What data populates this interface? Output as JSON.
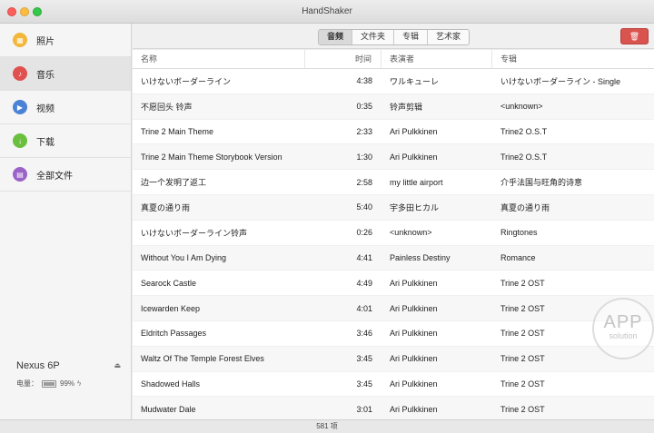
{
  "window": {
    "title": "HandShaker"
  },
  "sidebar": {
    "items": [
      {
        "label": "照片",
        "icon": "photo-icon",
        "color": "#f2b73b",
        "glyph": "▦"
      },
      {
        "label": "音乐",
        "icon": "music-icon",
        "color": "#e0504f",
        "glyph": "♪"
      },
      {
        "label": "视频",
        "icon": "video-icon",
        "color": "#4a82d6",
        "glyph": "▶"
      },
      {
        "label": "下载",
        "icon": "download-icon",
        "color": "#6bbf3f",
        "glyph": "↓"
      },
      {
        "label": "全部文件",
        "icon": "files-icon",
        "color": "#9b63c8",
        "glyph": "▤"
      }
    ],
    "device": {
      "name": "Nexus 6P",
      "battery_label": "电量：",
      "battery_percent": "99%",
      "battery_level": 0.99
    }
  },
  "toolbar": {
    "tabs": [
      "音频",
      "文件夹",
      "专辑",
      "艺术家"
    ],
    "active_tab": "音频",
    "delete_color": "#d9534f"
  },
  "table": {
    "columns": [
      "名称",
      "时间",
      "表演者",
      "专辑"
    ],
    "rows": [
      [
        "いけないボーダーライン",
        "4:38",
        "ワルキューレ",
        "いけないボーダーライン - Single"
      ],
      [
        "不愿回头 铃声",
        "0:35",
        "铃声剪辑",
        "<unknown>"
      ],
      [
        "Trine 2 Main Theme",
        "2:33",
        "Ari Pulkkinen",
        "Trine2 O.S.T"
      ],
      [
        "Trine 2 Main Theme Storybook Version",
        "1:30",
        "Ari Pulkkinen",
        "Trine2 O.S.T"
      ],
      [
        "边一个发明了返工",
        "2:58",
        "my little airport",
        "介乎法国与旺角的诗意"
      ],
      [
        "真夏の通り雨",
        "5:40",
        "宇多田ヒカル",
        "真夏の通り雨"
      ],
      [
        "いけないボーダーライン铃声",
        "0:26",
        "<unknown>",
        "Ringtones"
      ],
      [
        "Without You I Am Dying",
        "4:41",
        "Painless Destiny",
        "Romance"
      ],
      [
        "Searock Castle",
        "4:49",
        "Ari Pulkkinen",
        "Trine 2 OST"
      ],
      [
        "Icewarden Keep",
        "4:01",
        "Ari Pulkkinen",
        "Trine 2 OST"
      ],
      [
        "Eldritch Passages",
        "3:46",
        "Ari Pulkkinen",
        "Trine 2 OST"
      ],
      [
        "Waltz Of The Temple Forest Elves",
        "3:45",
        "Ari Pulkkinen",
        "Trine 2 OST"
      ],
      [
        "Shadowed Halls",
        "3:45",
        "Ari Pulkkinen",
        "Trine 2 OST"
      ],
      [
        "Mudwater Dale",
        "3:01",
        "Ari Pulkkinen",
        "Trine 2 OST"
      ]
    ]
  },
  "watermark": {
    "line1": "APP",
    "line2": "solution"
  },
  "status": {
    "count": "581 项"
  }
}
